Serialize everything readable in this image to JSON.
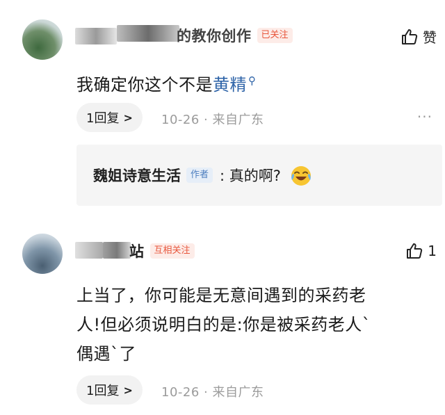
{
  "comments": [
    {
      "name": "的教你创作",
      "tag": "已关注",
      "like_label": "赞",
      "content_prefix": "我确定你这个不是",
      "content_link": "黄精",
      "search_mark": "⚲",
      "reply_pill": "1回复",
      "meta": "10-26 · 来自广东",
      "more": "···",
      "sub_reply": {
        "name": "魏姐诗意生活",
        "author_tag": "作者",
        "text": ": 真的啊?"
      }
    },
    {
      "name": "站",
      "tag": "互相关注",
      "like_count": "1",
      "content_lines": [
        "上当了，你可能是无意间遇到的采药老",
        "人!但必须说明白的是:你是被采药老人`",
        "偶遇`了"
      ],
      "reply_pill": "1回复",
      "meta": "10-26 · 来自广东"
    }
  ]
}
